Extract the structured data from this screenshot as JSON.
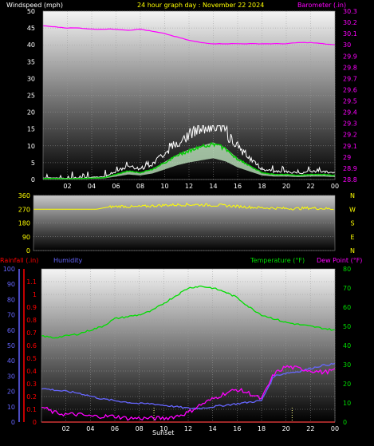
{
  "header": {
    "wind_label": "Windspeed (mph)",
    "title": "24 hour graph day : November 22 2024",
    "baro_label": "Barometer (.in)"
  },
  "time_ticks": [
    "02",
    "04",
    "06",
    "08",
    "10",
    "12",
    "14",
    "16",
    "18",
    "20",
    "22",
    "00"
  ],
  "sunset_label": "Sunset",
  "wind_dir_letters": [
    "N",
    "W",
    "S",
    "E",
    "N"
  ],
  "bottom_labels": {
    "rain": "Rainfall (.in)",
    "humidity": "Humidity",
    "temperature": "Temperature (°F)",
    "dewpoint": "Dew Point (°F)"
  },
  "colors": {
    "wind_avg": "#ffffff",
    "wind_gust": "#ffffff",
    "wind_avg_line": "#00cc00",
    "wind_band": "#c8f0c8",
    "barometer": "#ff00ff",
    "wind_dir": "#ffff00",
    "rain": "#ff0000",
    "humidity": "#6666ff",
    "temperature": "#00dd00",
    "dewpoint": "#ff00ff"
  },
  "chart_data": [
    {
      "type": "line",
      "title": "24 hour graph day : November 22 2024",
      "xlabel": "",
      "x": [
        0,
        1,
        2,
        3,
        4,
        5,
        6,
        7,
        8,
        9,
        10,
        11,
        12,
        13,
        14,
        15,
        16,
        17,
        18,
        19,
        20,
        21,
        22,
        23,
        24
      ],
      "series": [
        {
          "name": "Windspeed (mph)",
          "axis": "left",
          "values": [
            0.3,
            0.3,
            0.2,
            0.3,
            0.4,
            0.5,
            1.5,
            2.5,
            2.0,
            3.0,
            5.0,
            7.0,
            8.5,
            9.5,
            10.5,
            9.0,
            6.0,
            4.0,
            2.0,
            1.5,
            1.5,
            1.2,
            1.5,
            1.5,
            1.2
          ]
        },
        {
          "name": "Barometer (.in)",
          "axis": "right",
          "values": [
            30.17,
            30.16,
            30.15,
            30.15,
            30.14,
            30.14,
            30.14,
            30.13,
            30.14,
            30.12,
            30.1,
            30.07,
            30.04,
            30.02,
            30.01,
            30.01,
            30.01,
            30.01,
            30.01,
            30.01,
            30.01,
            30.02,
            30.02,
            30.01,
            30.0
          ]
        }
      ],
      "ylabel_left": "Windspeed (mph)",
      "ylim_left": [
        0,
        50
      ],
      "yticks_left": [
        0,
        5,
        10,
        15,
        20,
        25,
        30,
        35,
        40,
        45,
        50
      ],
      "ylabel_right": "Barometer (.in)",
      "ylim_right": [
        28.8,
        30.3
      ],
      "yticks_right": [
        "28.8",
        "28.9",
        "29",
        "29.1",
        "29.2",
        "29.3",
        "29.4",
        "29.5",
        "29.6",
        "29.7",
        "29.8",
        "29.9",
        "30",
        "30.1",
        "30.2",
        "30.3"
      ],
      "grid": true
    },
    {
      "type": "line",
      "x": [
        0,
        1,
        2,
        3,
        4,
        5,
        6,
        7,
        8,
        9,
        10,
        11,
        12,
        13,
        14,
        15,
        16,
        17,
        18,
        19,
        20,
        21,
        22,
        23,
        24
      ],
      "series": [
        {
          "name": "Wind Direction",
          "values": [
            270,
            270,
            270,
            270,
            270,
            270,
            285,
            290,
            285,
            290,
            295,
            298,
            300,
            300,
            297,
            295,
            290,
            285,
            280,
            278,
            275,
            275,
            278,
            275,
            272
          ]
        }
      ],
      "ylim": [
        0,
        360
      ],
      "yticks": [
        0,
        90,
        180,
        270,
        360
      ],
      "grid": true
    },
    {
      "type": "line",
      "x": [
        0,
        1,
        2,
        3,
        4,
        5,
        6,
        7,
        8,
        9,
        10,
        11,
        12,
        13,
        14,
        15,
        16,
        17,
        18,
        19,
        20,
        21,
        22,
        23,
        24
      ],
      "series": [
        {
          "name": "Rainfall (.in)",
          "axis": "left",
          "values": [
            0,
            0,
            0,
            0,
            0,
            0,
            0,
            0,
            0,
            0,
            0,
            0,
            0,
            0,
            0,
            0,
            0,
            0,
            0,
            0,
            0,
            0,
            0,
            0,
            0
          ]
        },
        {
          "name": "Humidity",
          "axis": "far-left",
          "values": [
            22,
            21,
            20,
            19,
            17,
            15,
            14,
            13,
            12,
            12,
            11,
            10,
            9,
            9,
            10,
            11,
            12,
            13,
            14,
            30,
            32,
            33,
            35,
            37,
            38
          ]
        },
        {
          "name": "Temperature (°F)",
          "axis": "right",
          "values": [
            45,
            44,
            45,
            46,
            48,
            50,
            54,
            55,
            56,
            58,
            62,
            66,
            70,
            71,
            70,
            68,
            65,
            60,
            56,
            54,
            52,
            51,
            50,
            49,
            48
          ]
        },
        {
          "name": "Dew Point (°F)",
          "axis": "right",
          "values": [
            8,
            5,
            4,
            4,
            3,
            3,
            3,
            2,
            2,
            2,
            2,
            3,
            5,
            9,
            12,
            15,
            17,
            15,
            12,
            25,
            29,
            28,
            27,
            26,
            27
          ]
        }
      ],
      "ylabel_left": "Rainfall (.in)",
      "ylim_left": [
        0,
        1.2
      ],
      "yticks_left": [
        "0",
        "0.1",
        "0.2",
        "0.3",
        "0.4",
        "0.5",
        "0.6",
        "0.7",
        "0.8",
        "0.9",
        "1",
        "1.1"
      ],
      "ylim_far_left": [
        0,
        100
      ],
      "yticks_far_left": [
        0,
        10,
        20,
        30,
        40,
        50,
        60,
        70,
        80,
        90,
        100
      ],
      "ylabel_right": "Temperature (°F)",
      "ylim_right": [
        0,
        80
      ],
      "yticks_right": [
        0,
        10,
        20,
        30,
        40,
        50,
        60,
        70,
        80
      ],
      "grid": true
    }
  ]
}
